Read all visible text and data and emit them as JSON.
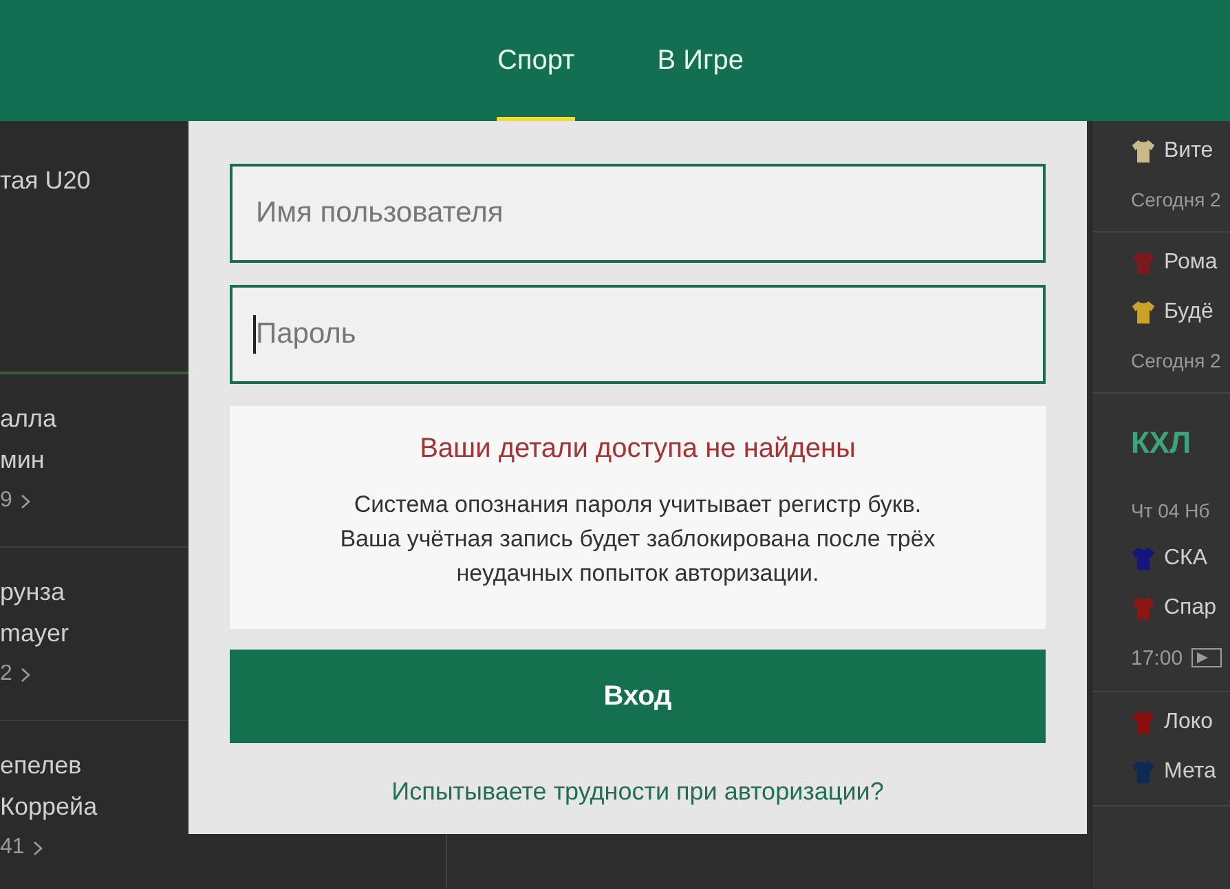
{
  "header": {
    "tabs": [
      {
        "label": "Спорт",
        "selected": true
      },
      {
        "label": "В Игре",
        "selected": false
      }
    ]
  },
  "left_feed": {
    "groups": [
      {
        "lines": [
          "тая U20"
        ]
      },
      {
        "lines": [
          "алла",
          "мин"
        ],
        "count": "9"
      },
      {
        "lines": [
          "рунза",
          "mayer"
        ],
        "count": "2"
      },
      {
        "lines": [
          "епелев",
          "Коррейа"
        ],
        "count": "41"
      }
    ]
  },
  "right_feed": {
    "groups": [
      {
        "rows": [
          {
            "kind": "team",
            "text": "Вите",
            "color": "#c8b98a"
          },
          {
            "kind": "date",
            "text": "Сегодня 2"
          }
        ]
      },
      {
        "rows": [
          {
            "kind": "team",
            "text": "Рома",
            "color": "#7a1a1e"
          },
          {
            "kind": "team",
            "text": "Будё",
            "color": "#c9a227"
          },
          {
            "kind": "date",
            "text": "Сегодня 2"
          }
        ]
      },
      {
        "rows": [
          {
            "kind": "league",
            "text": "КХЛ"
          },
          {
            "kind": "date",
            "text": "Чт 04 Нб"
          },
          {
            "kind": "team",
            "text": "СКА",
            "color": "#15157f"
          },
          {
            "kind": "team",
            "text": "Спар",
            "color": "#8a1616"
          },
          {
            "kind": "time",
            "text": "17:00"
          }
        ]
      },
      {
        "rows": [
          {
            "kind": "team",
            "text": "Локо",
            "color": "#8a1010"
          },
          {
            "kind": "team",
            "text": "Мета",
            "color": "#0d2a55"
          }
        ]
      }
    ]
  },
  "login": {
    "username": {
      "placeholder": "Имя пользователя",
      "focused": false
    },
    "password": {
      "placeholder": "Пароль",
      "focused": true
    },
    "error": {
      "title": "Ваши детали доступа не найдены",
      "message": [
        "Система опознания пароля учитывает регистр букв.",
        "Ваша учётная запись будет заблокирована после трёх",
        "неудачных попыток авторизации."
      ]
    },
    "submit": "Вход",
    "help_link": "Испытываете трудности при авторизации?"
  }
}
